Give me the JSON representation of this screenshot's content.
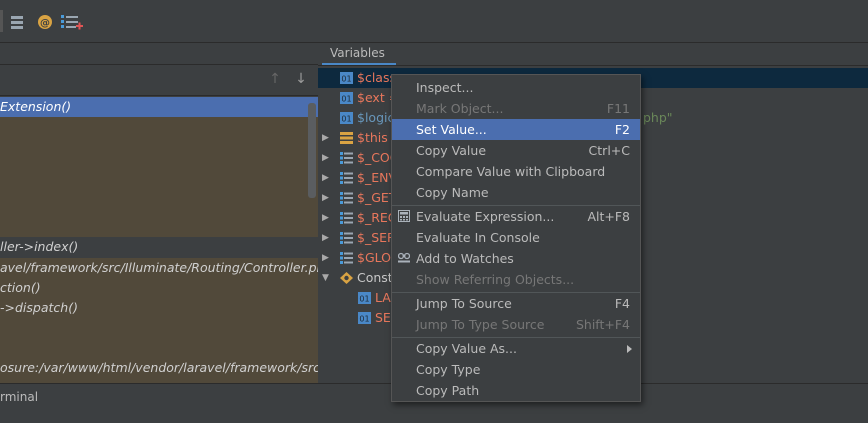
{
  "toolbar": {
    "icons": [
      "stack-icon",
      "at-sign-icon",
      "ordered-list-icon",
      "list-add-icon"
    ]
  },
  "frames": {
    "nav_up": "↑",
    "nav_down": "↓",
    "items": [
      {
        "text": "Extension()",
        "selected": true
      },
      {
        "text": "ller->index()"
      },
      {
        "text": "avel/framework/src/Illuminate/Routing/Controller.php:5"
      },
      {
        "text": "ction()"
      },
      {
        "text": "->dispatch()"
      },
      {
        "text": "osure:/var/www/html/vendor/laravel/framework/src/Illu"
      }
    ]
  },
  "variables": {
    "tab_label": "Variables",
    "rows": [
      {
        "name": "$class",
        "kind": "object",
        "color": "red",
        "tail": "",
        "selected": true
      },
      {
        "name": "$ext =",
        "kind": "object",
        "color": "red",
        "tail": ""
      },
      {
        "name": "$logic",
        "kind": "object",
        "color": "blue",
        "tail": "php\""
      },
      {
        "name": "$this",
        "kind": "this",
        "color": "red",
        "tail": "",
        "expandable": true
      },
      {
        "name": "$_COO",
        "kind": "array",
        "color": "red",
        "expandable": true
      },
      {
        "name": "$_ENV",
        "kind": "array",
        "color": "red",
        "expandable": true
      },
      {
        "name": "$_GET",
        "kind": "array",
        "color": "red",
        "expandable": true
      },
      {
        "name": "$_REQ",
        "kind": "array",
        "color": "red",
        "expandable": true
      },
      {
        "name": "$_SER",
        "kind": "array",
        "color": "red",
        "expandable": true
      },
      {
        "name": "$GLO",
        "kind": "array",
        "color": "red",
        "expandable": true
      },
      {
        "name": "Const",
        "kind": "constant",
        "color": "white",
        "expanded": true
      },
      {
        "name": "LA",
        "kind": "object",
        "color": "red",
        "indent": true
      },
      {
        "name": "SE",
        "kind": "object",
        "color": "red",
        "indent": true
      }
    ]
  },
  "statusbar": {
    "terminal_label": "rminal"
  },
  "context_menu": {
    "items": [
      {
        "label": "Inspect...",
        "shortcut": "",
        "disabled": false
      },
      {
        "label": "Mark Object...",
        "shortcut": "F11",
        "disabled": true
      },
      {
        "label": "Set Value...",
        "shortcut": "F2",
        "highlighted": true
      },
      {
        "label": "Copy Value",
        "shortcut": "Ctrl+C"
      },
      {
        "label": "Compare Value with Clipboard",
        "shortcut": ""
      },
      {
        "label": "Copy Name",
        "shortcut": ""
      },
      {
        "sep": true
      },
      {
        "label": "Evaluate Expression...",
        "shortcut": "Alt+F8",
        "icon": "calculator-icon"
      },
      {
        "label": "Evaluate In Console",
        "shortcut": ""
      },
      {
        "label": "Add to Watches",
        "shortcut": "",
        "icon": "watches-icon"
      },
      {
        "label": "Show Referring Objects...",
        "shortcut": "",
        "disabled": true
      },
      {
        "sep": true
      },
      {
        "label": "Jump To Source",
        "shortcut": "F4"
      },
      {
        "label": "Jump To Type Source",
        "shortcut": "Shift+F4",
        "disabled": true
      },
      {
        "sep": true
      },
      {
        "label": "Copy Value As...",
        "shortcut": "",
        "submenu": true
      },
      {
        "label": "Copy Type",
        "shortcut": ""
      },
      {
        "label": "Copy Path",
        "shortcut": ""
      }
    ]
  },
  "colors": {
    "selection": "#4b6eaf",
    "library_frame": "#51493a",
    "variable_red": "#e8775c",
    "variable_blue": "#6897bb"
  }
}
